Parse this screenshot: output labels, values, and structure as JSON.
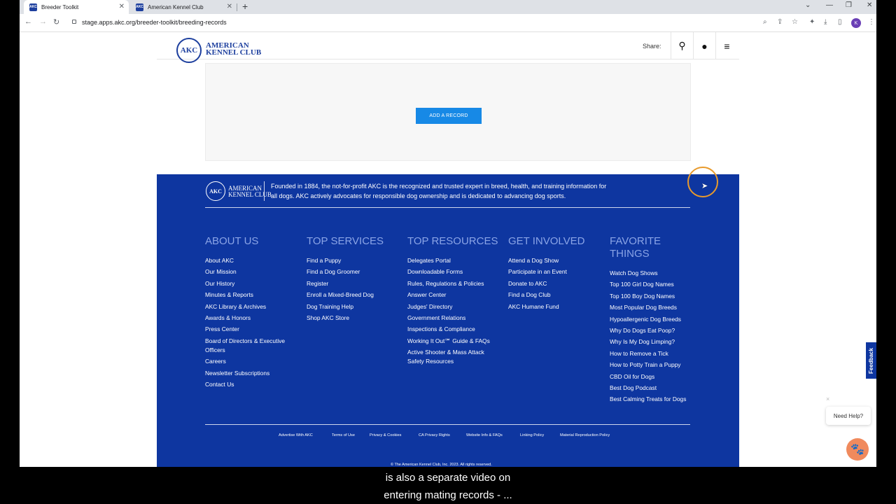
{
  "browser": {
    "tabs": [
      {
        "label": "Breeder Toolkit",
        "favicon": "AKC"
      },
      {
        "label": "American Kennel Club",
        "favicon": "AKC"
      }
    ],
    "new_tab": "+",
    "url": "stage.apps.akc.org/breeder-toolkit/breeding-records",
    "profile_initial": "K"
  },
  "header": {
    "logo_seal": "AKC",
    "logo_line1": "AMERICAN",
    "logo_line2": "KENNEL CLUB",
    "share_label": "Share:"
  },
  "records": {
    "add_button": "ADD A RECORD"
  },
  "footer": {
    "seal": "AKC",
    "logo_line1": "AMERICAN",
    "logo_line2": "KENNEL CLUB",
    "about": "Founded in 1884, the not-for-profit AKC is the recognized and trusted expert in breed, health, and training information for all dogs. AKC actively advocates for responsible dog ownership and is dedicated to advancing dog sports.",
    "columns": [
      {
        "title": "ABOUT US",
        "items": [
          "About AKC",
          "Our Mission",
          "Our History",
          "Minutes & Reports",
          "AKC Library & Archives",
          "Awards & Honors",
          "Press Center",
          "Board of Directors & Executive Officers",
          "Careers",
          "Newsletter Subscriptions",
          "Contact Us"
        ]
      },
      {
        "title": "TOP SERVICES",
        "items": [
          "Find a Puppy",
          "Find a Dog Groomer",
          "Register",
          "Enroll a Mixed-Breed Dog",
          "Dog Training Help",
          "Shop AKC Store"
        ]
      },
      {
        "title": "TOP RESOURCES",
        "items": [
          "Delegates Portal",
          "Downloadable Forms",
          "Rules, Regulations & Policies",
          "Answer Center",
          "Judges' Directory",
          "Government Relations",
          "Inspections & Compliance",
          "Working It Out℠ Guide & FAQs",
          "Active Shooter & Mass Attack Safety Resources"
        ]
      },
      {
        "title": "GET INVOLVED",
        "items": [
          "Attend a Dog Show",
          "Participate in an Event",
          "Donate to AKC",
          "Find a Dog Club",
          "AKC Humane Fund"
        ]
      },
      {
        "title": "FAVORITE THINGS",
        "items": [
          "Watch Dog Shows",
          "Top 100 Girl Dog Names",
          "Top 100 Boy Dog Names",
          "Most Popular Dog Breeds",
          "Hypoallergenic Dog Breeds",
          "Why Do Dogs Eat Poop?",
          "Why Is My Dog Limping?",
          "How to Remove a Tick",
          "How to Potty Train a Puppy",
          "CBD Oil for Dogs",
          "Best Dog Podcast",
          "Best Calming Treats for Dogs"
        ]
      }
    ],
    "legal_links": [
      "Advertise With AKC",
      "Terms of Use",
      "Privacy & Cookies",
      "CA Privacy Rights",
      "Website Info & FAQs",
      "Linking Policy",
      "Material Reproduction Policy"
    ],
    "copyright": "© The American Kennel Club, Inc. 2023. All rights reserved."
  },
  "widgets": {
    "feedback": "Feedback",
    "help": "Need Help?",
    "help_close": "×"
  },
  "caption": {
    "line1": "is also a separate video on",
    "line2": "entering mating records - ..."
  }
}
